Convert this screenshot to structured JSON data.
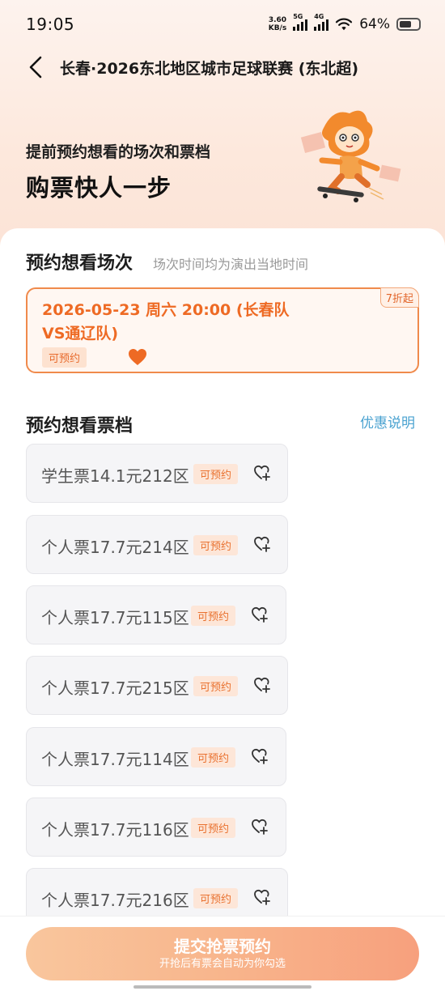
{
  "status_bar": {
    "time": "19:05",
    "net_speed_value": "3.60",
    "net_speed_unit": "KB/s",
    "signal1_label": "5G",
    "signal2_label": "4G",
    "battery_percent": "64%",
    "battery_level": 0.64
  },
  "header": {
    "title": "长春·2026东北地区城市足球联赛 (东北超)"
  },
  "hero": {
    "line1": "提前预约想看的场次和票档",
    "line2": "购票快人一步"
  },
  "session_section": {
    "title": "预约想看场次",
    "hint": "场次时间均为演出当地时间",
    "session": {
      "text": "2026-05-23 周六 20:00 (长春队VS通辽队)",
      "discount": "7折起",
      "badge": "可预约"
    }
  },
  "ticket_section": {
    "title": "预约想看票档",
    "promo_link": "优惠说明",
    "tickets": [
      {
        "label": "学生票14.1元212区",
        "badge": "可预约"
      },
      {
        "label": "个人票17.7元214区",
        "badge": "可预约"
      },
      {
        "label": "个人票17.7元115区",
        "badge": "可预约"
      },
      {
        "label": "个人票17.7元215区",
        "badge": "可预约"
      },
      {
        "label": "个人票17.7元114区",
        "badge": "可预约"
      },
      {
        "label": "个人票17.7元116区",
        "badge": "可预约"
      },
      {
        "label": "个人票17.7元216区",
        "badge": "可预约"
      }
    ]
  },
  "submit": {
    "main_label": "提交抢票预约",
    "sub_label": "开抢后有票会自动为你勾选"
  },
  "colors": {
    "accent": "#ee6a24",
    "link": "#4aa2d0",
    "button_gradient_start": "#f9c69d",
    "button_gradient_end": "#f7a07d"
  }
}
